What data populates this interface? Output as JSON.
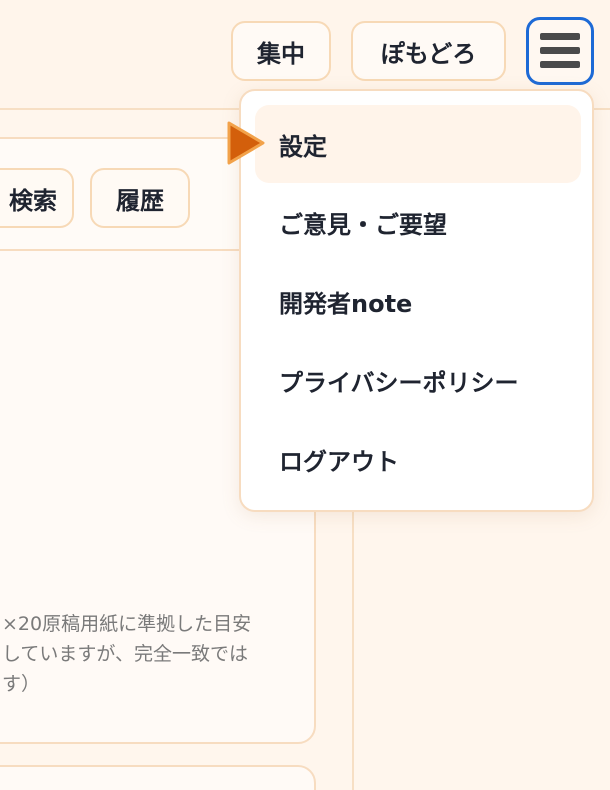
{
  "header": {
    "focus_label": "集中",
    "pomodoro_label": "ぽもどろ",
    "menu_icon": "hamburger-menu-icon"
  },
  "toolbar": {
    "search_label": "検索",
    "history_label": "履歴"
  },
  "editor": {
    "note_line1": "×20原稿用紙に準拠した目安",
    "note_line2": "していますが、完全一致では",
    "note_line3": "す）"
  },
  "menu": {
    "items": [
      {
        "label": "設定",
        "active": true
      },
      {
        "label": "ご意見・ご要望",
        "active": false
      },
      {
        "label": "開発者note",
        "active": false
      },
      {
        "label": "プライバシーポリシー",
        "active": false
      },
      {
        "label": "ログアウト",
        "active": false
      }
    ],
    "pointer_icon": "selection-pointer-icon"
  },
  "colors": {
    "accent_border": "#1d6ad6",
    "pointer_fill": "#d35f0b",
    "pointer_stroke": "#f2a24a",
    "panel_border": "#f7dcc0",
    "background": "#fff6ed"
  }
}
